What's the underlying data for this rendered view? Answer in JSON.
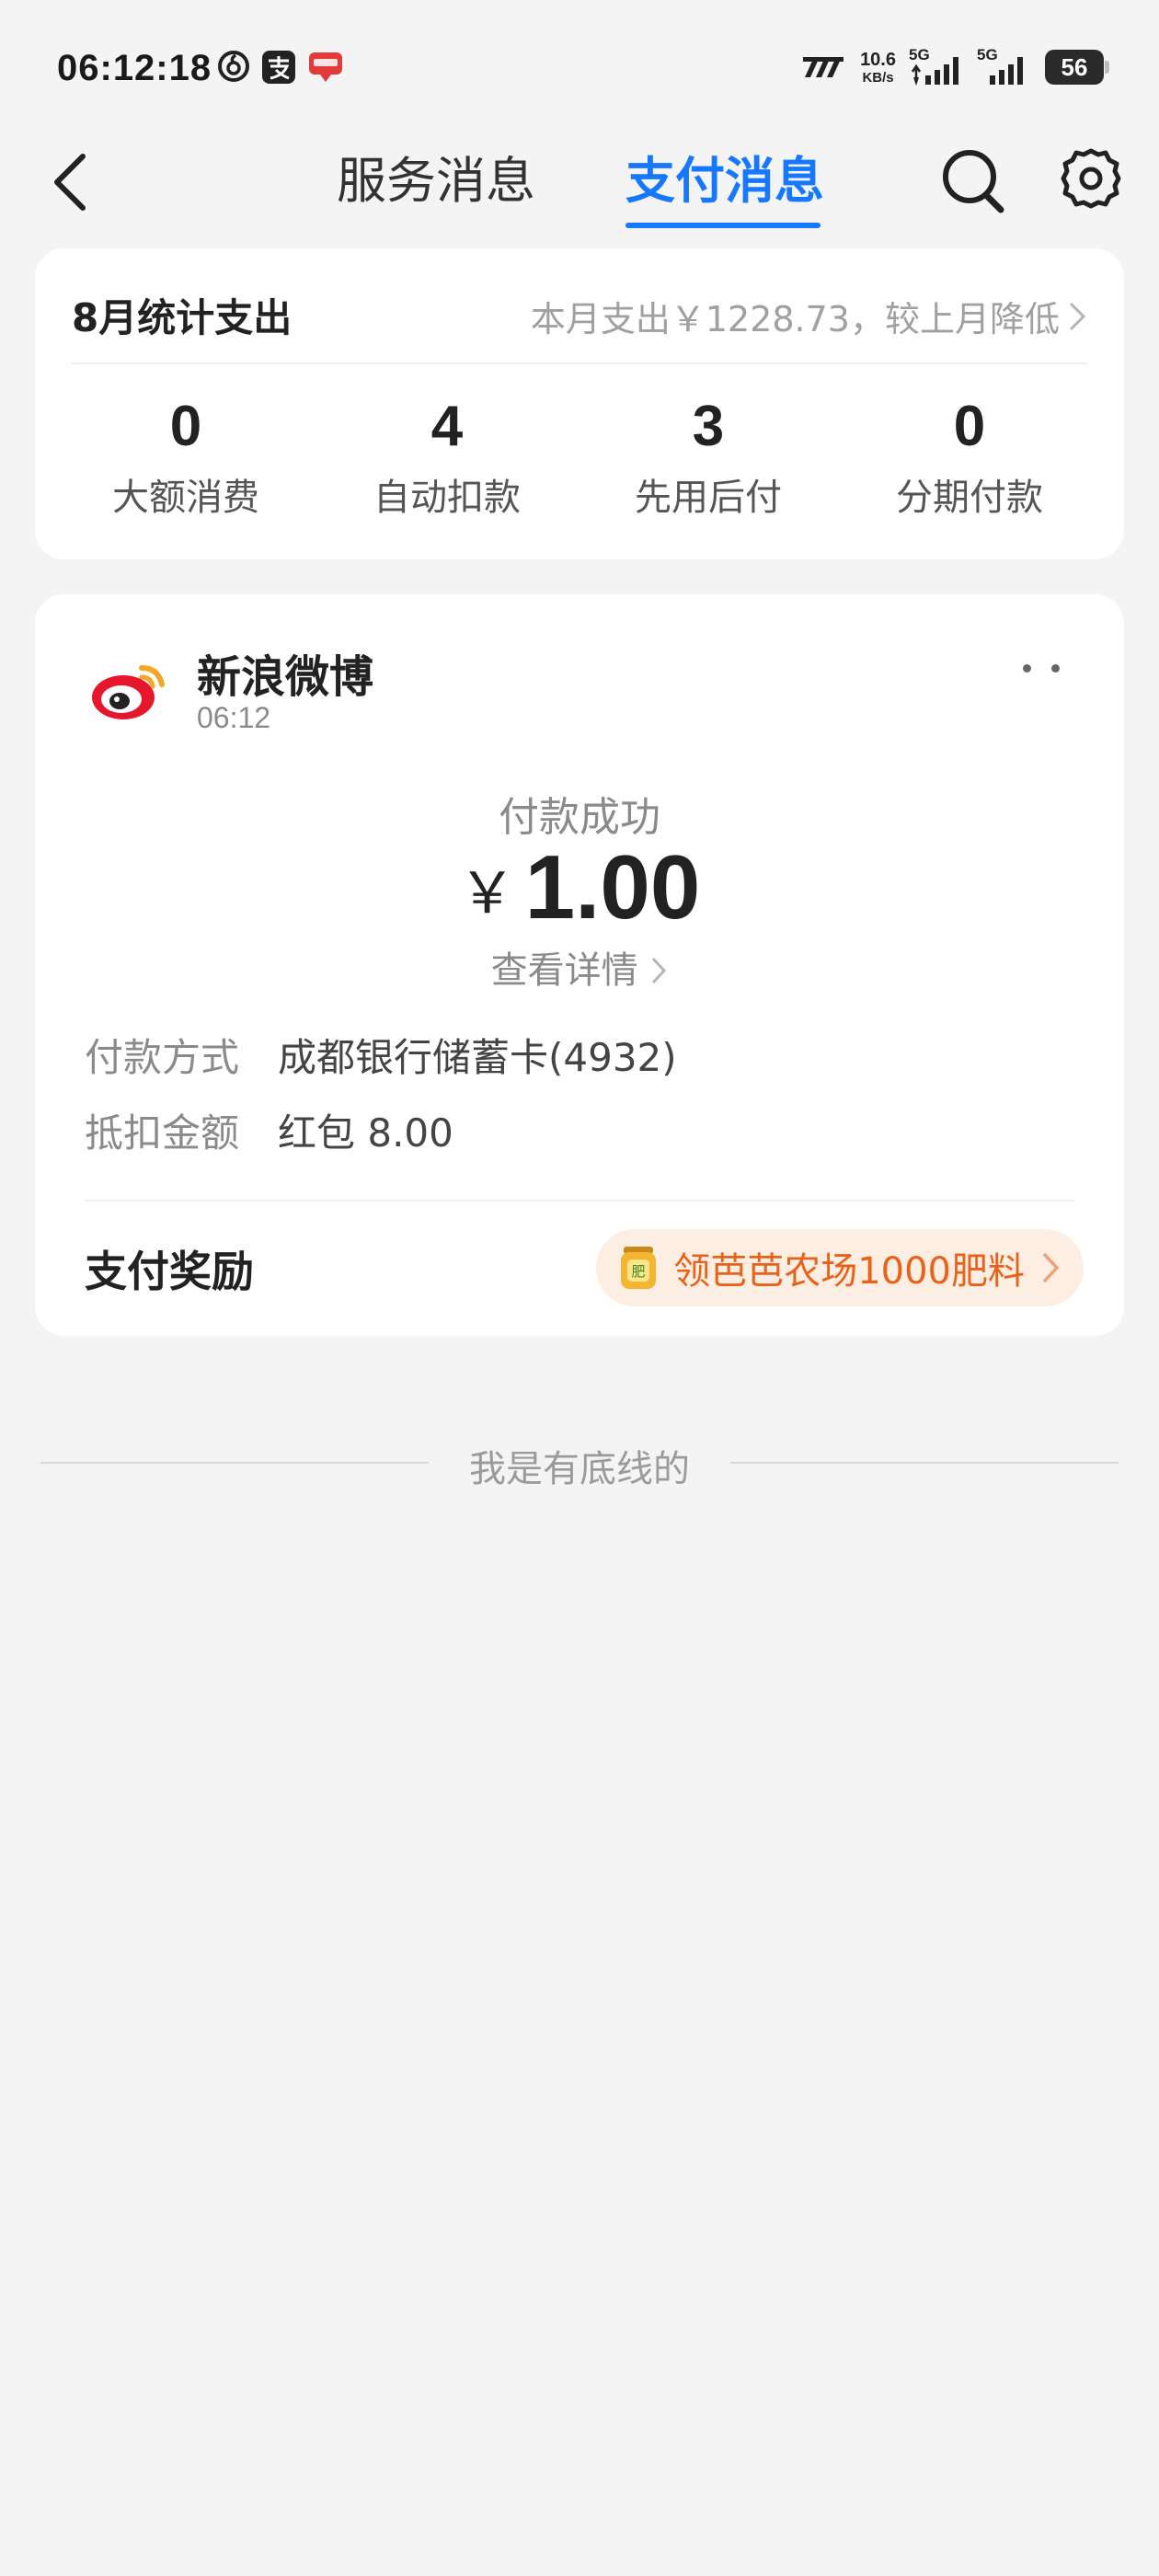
{
  "status_bar": {
    "time": "06:12:18",
    "network_speed_value": "10.6",
    "network_speed_unit": "KB/s",
    "signal1_label": "5G",
    "signal2_label": "5G",
    "battery": "56"
  },
  "nav": {
    "tabs": [
      {
        "label": "服务消息",
        "active": false
      },
      {
        "label": "支付消息",
        "active": true
      }
    ]
  },
  "stats": {
    "title": "8月统计支出",
    "summary": "本月支出￥1228.73，较上月降低",
    "items": [
      {
        "value": "0",
        "label": "大额消费"
      },
      {
        "value": "4",
        "label": "自动扣款"
      },
      {
        "value": "3",
        "label": "先用后付"
      },
      {
        "value": "0",
        "label": "分期付款"
      }
    ]
  },
  "message": {
    "merchant": "新浪微博",
    "time": "06:12",
    "status": "付款成功",
    "currency": "￥",
    "amount": "1.00",
    "detail_link": "查看详情",
    "rows": [
      {
        "key": "付款方式",
        "value": "成都银行储蓄卡(4932)"
      },
      {
        "key": "抵扣金额",
        "value": "红包 8.00"
      }
    ],
    "reward_title": "支付奖励",
    "reward_text": "领芭芭农场1000肥料",
    "reward_icon_text": "肥"
  },
  "footer": {
    "text": "我是有底线的"
  },
  "colors": {
    "accent": "#1677ff",
    "reward_orange": "#e8621a",
    "reward_bg": "#fdeee4",
    "weibo_red": "#e6162d"
  }
}
